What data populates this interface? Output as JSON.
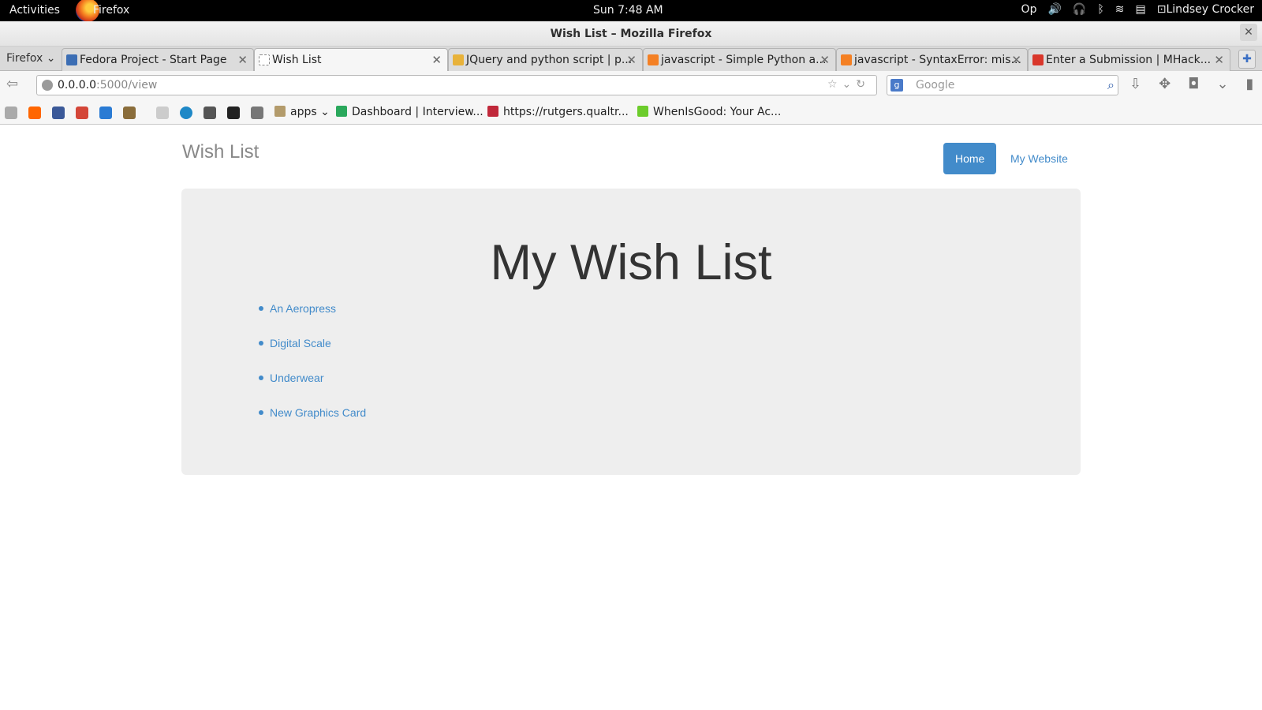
{
  "os_topbar": {
    "activities": "Activities",
    "app_name": "Firefox",
    "clock": "Sun  7:48 AM",
    "indicator": "Op",
    "user": "Lindsey Crocker"
  },
  "window": {
    "title": "Wish List – Mozilla Firefox"
  },
  "browser": {
    "menu_label": "Firefox",
    "tabs": [
      {
        "label": "Fedora Project - Start Page",
        "active": false
      },
      {
        "label": "Wish List",
        "active": true
      },
      {
        "label": "JQuery and python script | p...",
        "active": false
      },
      {
        "label": "javascript - Simple Python a...",
        "active": false
      },
      {
        "label": "javascript - SyntaxError: mis...",
        "active": false
      },
      {
        "label": "Enter a Submission | MHack...",
        "active": false
      }
    ],
    "url_host": "0.0.0.0",
    "url_path": ":5000/view",
    "search_placeholder": "Google",
    "bookmarks": {
      "folder": "apps",
      "items": [
        "Dashboard | Interview...",
        "https://rutgers.qualtr...",
        "WhenIsGood: Your Ac..."
      ]
    }
  },
  "page": {
    "brand": "Wish List",
    "nav": {
      "home": "Home",
      "website": "My Website"
    },
    "heading": "My Wish List",
    "items": [
      "An Aeropress",
      "Digital Scale",
      "Underwear",
      "New Graphics Card"
    ],
    "colors": {
      "primary": "#428bca",
      "jumbotron_bg": "#eeeeee"
    }
  }
}
